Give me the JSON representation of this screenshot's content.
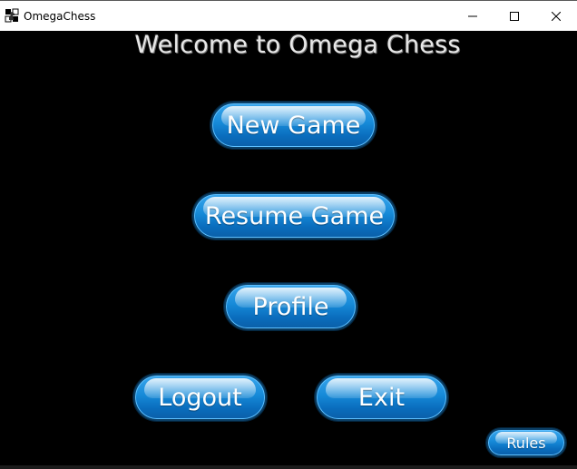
{
  "window": {
    "title": "OmegaChess"
  },
  "main": {
    "welcome_text": "Welcome to Omega Chess",
    "buttons": {
      "new_game": "New Game",
      "resume_game": "Resume Game",
      "profile": "Profile",
      "logout": "Logout",
      "exit": "Exit",
      "rules": "Rules"
    }
  },
  "colors": {
    "background": "#000000",
    "button_blue": "#168ad8",
    "button_border": "#0b3f66",
    "title_bar": "#ffffff"
  },
  "icons": {
    "app": "chess-knight-icon",
    "minimize": "minimize-icon",
    "maximize": "maximize-icon",
    "close": "close-icon"
  }
}
